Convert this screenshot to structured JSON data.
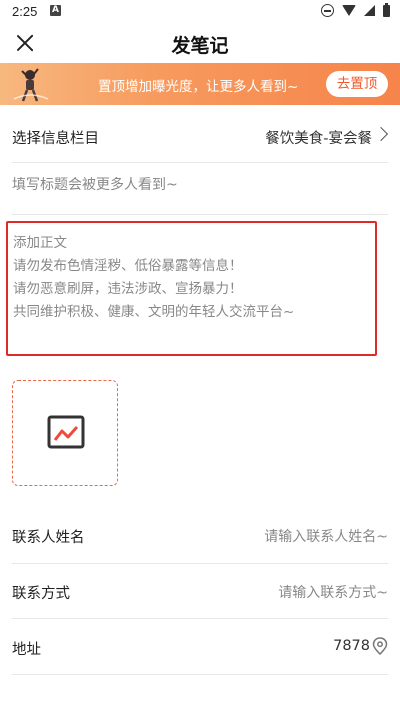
{
  "status_bar": {
    "time": "2:25",
    "notification_letter": "A",
    "icons": [
      "do-not-disturb-icon",
      "wifi-icon",
      "signal-icon",
      "battery-icon"
    ]
  },
  "header": {
    "title": "发笔记",
    "close_icon": "close-icon"
  },
  "promo": {
    "text": "置顶增加曝光度，让更多人看到~",
    "button_label": "去置顶",
    "colors": {
      "start": "#f7b87f",
      "end": "#f6844a",
      "button_text": "#f05a2a"
    }
  },
  "form": {
    "category": {
      "label": "选择信息栏目",
      "value": "餐饮美食-宴会餐"
    },
    "title": {
      "placeholder": "填写标题会被更多人看到~"
    },
    "body": {
      "lines": [
        "添加正文",
        "请勿发布色情淫秽、低俗暴露等信息！",
        "请勿恶意刷屏，违法涉政、宣扬暴力！",
        "共同维护积极、健康、文明的年轻人交流平台~"
      ],
      "highlight_color": "#e02a2a"
    },
    "image_picker": {
      "icon": "image-icon"
    },
    "contact_name": {
      "label": "联系人姓名",
      "placeholder": "请输入联系人姓名~"
    },
    "contact_method": {
      "label": "联系方式",
      "placeholder": "请输入联系方式~"
    },
    "address": {
      "label": "地址",
      "value": "7878",
      "icon": "location-pin-icon"
    }
  }
}
